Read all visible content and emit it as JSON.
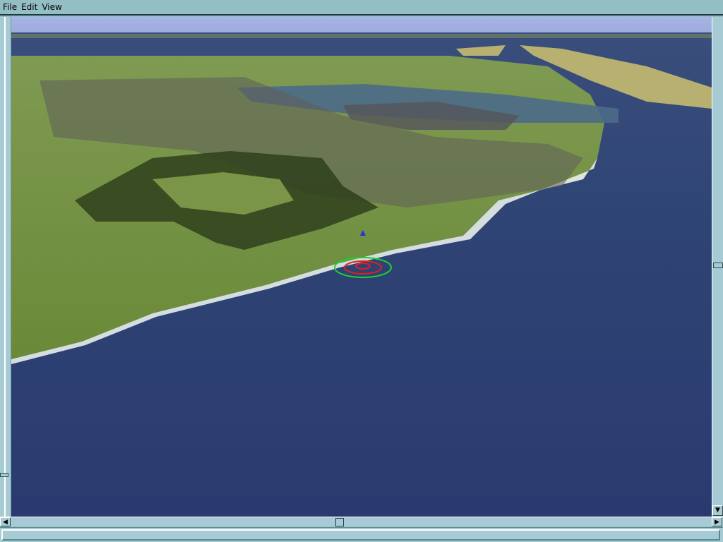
{
  "menu": {
    "items": [
      "File",
      "Edit",
      "View"
    ]
  },
  "scene": {
    "description_icon": "terrain-3d-view",
    "sky_color": "#9fb0e0",
    "sea_color": "#2d3a6e",
    "land_color": "#6f8a3c"
  },
  "statusbar": {
    "text": ""
  }
}
